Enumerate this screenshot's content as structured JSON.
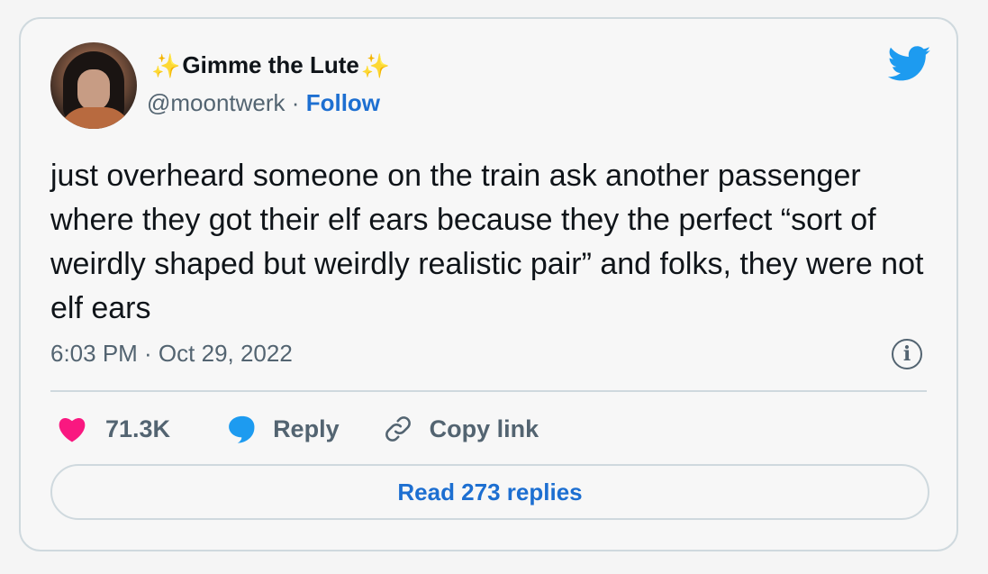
{
  "author": {
    "display_name": "Gimme the Lute",
    "sparkle_left": "✨",
    "sparkle_right": "✨",
    "handle": "@moontwerk",
    "separator": "·",
    "follow_label": "Follow"
  },
  "tweet": {
    "text": "just overheard someone on the train ask another passenger where they got their elf ears because they the perfect “sort of weirdly shaped but weirdly realistic pair” and folks, they were not elf ears",
    "timestamp": "6:03 PM · Oct 29, 2022"
  },
  "actions": {
    "like_count": "71.3K",
    "reply_label": "Reply",
    "copy_link_label": "Copy link"
  },
  "footer": {
    "read_replies_label": "Read 273 replies"
  },
  "colors": {
    "accent": "#1d6fd1",
    "twitter_blue": "#1d9bf0",
    "heart": "#f91880",
    "muted": "#536471",
    "text": "#0f1419"
  },
  "icons": {
    "brand": "twitter-bird-icon",
    "info": "info-icon",
    "like": "heart-icon",
    "reply": "speech-bubble-icon",
    "copy": "link-icon"
  }
}
